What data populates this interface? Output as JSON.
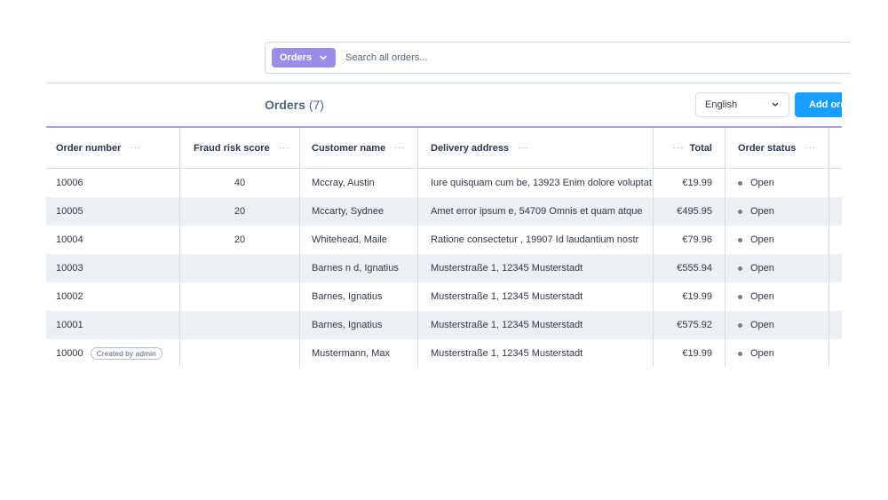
{
  "search": {
    "type_label": "Orders",
    "placeholder": "Search all orders..."
  },
  "page": {
    "title": "Orders",
    "count": "(7)",
    "language": "English",
    "add_button_label": "Add ord"
  },
  "table": {
    "columns": [
      "Order number",
      "Fraud risk score",
      "Customer name",
      "Delivery address",
      "Total",
      "Order status"
    ],
    "rows": [
      {
        "order_number": "10006",
        "badge": "",
        "fraud": "40",
        "customer": "Mccray, Austin",
        "address": "Iure quisquam cum be, 13923 Enim dolore voluptat",
        "total": "€19.99",
        "status": "Open"
      },
      {
        "order_number": "10005",
        "badge": "",
        "fraud": "20",
        "customer": "Mccarty, Sydnee",
        "address": "Amet error ipsum e, 54709 Omnis et quam atque",
        "total": "€495.95",
        "status": "Open"
      },
      {
        "order_number": "10004",
        "badge": "",
        "fraud": "20",
        "customer": "Whitehead, Maile",
        "address": "Ratione consectetur , 19907 Id laudantium nostr",
        "total": "€79.96",
        "status": "Open"
      },
      {
        "order_number": "10003",
        "badge": "",
        "fraud": "",
        "customer": "Barnes n d, Ignatius",
        "address": "Musterstraße 1, 12345 Musterstadt",
        "total": "€555.94",
        "status": "Open"
      },
      {
        "order_number": "10002",
        "badge": "",
        "fraud": "",
        "customer": "Barnes, Ignatius",
        "address": "Musterstraße 1, 12345 Musterstadt",
        "total": "€19.99",
        "status": "Open"
      },
      {
        "order_number": "10001",
        "badge": "",
        "fraud": "",
        "customer": "Barnes, Ignatius",
        "address": "Musterstraße 1, 12345 Musterstadt",
        "total": "€575.92",
        "status": "Open"
      },
      {
        "order_number": "10000",
        "badge": "Created by admin",
        "fraud": "",
        "customer": "Mustermann, Max",
        "address": "Musterstraße 1, 12345 Musterstadt",
        "total": "€19.99",
        "status": "Open"
      }
    ]
  },
  "icons": {
    "type_chevron": "chevron-down-icon",
    "language_chevron": "chevron-down-icon",
    "column_menu": "more-horizontal-icon",
    "status_dot": "status-dot-icon"
  },
  "colors": {
    "accent_purple": "#9b8ce8",
    "primary_blue": "#189eff",
    "alt_row": "#edf0f3",
    "header_line": "#a99cec"
  }
}
